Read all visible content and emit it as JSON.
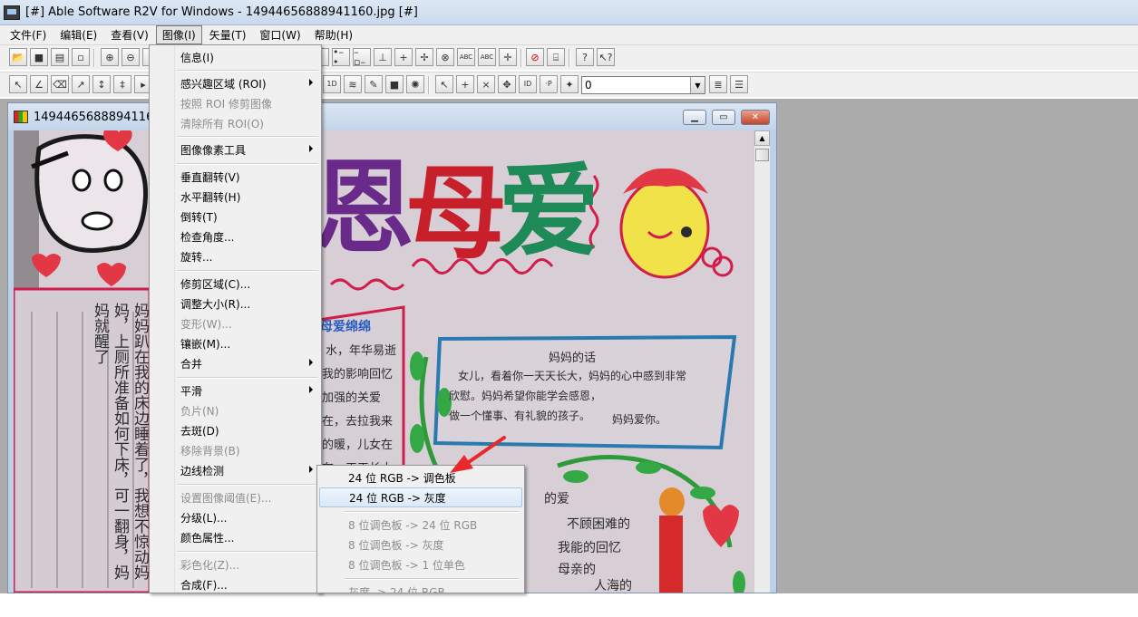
{
  "window": {
    "title": "[#] Able Software R2V for Windows - 14944656888941160.jpg [#]"
  },
  "menubar": {
    "items": [
      {
        "label": "文件(F)"
      },
      {
        "label": "编辑(E)"
      },
      {
        "label": "查看(V)"
      },
      {
        "label": "图像(I)"
      },
      {
        "label": "矢量(T)"
      },
      {
        "label": "窗口(W)"
      },
      {
        "label": "帮助(H)"
      }
    ]
  },
  "toolbar": {
    "zoom_value": "0"
  },
  "document": {
    "title": "14944656888941160.jpg"
  },
  "poster": {
    "title_chars": [
      "恩",
      "母",
      "爱"
    ],
    "box_heading": "妈妈的话",
    "box_text": [
      "女儿，看着你一天天长大，妈妈的心中感到非常",
      "欣慰。妈妈希望你能学会感恩，",
      "做一个懂事、有礼貌的孩子。",
      "妈妈爱你。"
    ],
    "section_label": "母爱绵绵",
    "left_column_text": "妈妈趴在我的床边睡着了，我想不惊动妈妈，上厕所准备如何下床，可一翻身，妈妈就醒了",
    "mid_text": [
      "水，年华易逝",
      "我的影响回忆",
      "加强的关爱",
      "在，去拉我来",
      "的暖，儿女在",
      "在一天天长大"
    ],
    "lower_text": [
      "的爱",
      "不顾困难的",
      "我能的回忆",
      "母亲的",
      "人海的"
    ]
  },
  "image_menu": {
    "items": [
      {
        "label": "信息(I)"
      },
      {
        "label": "感兴趣区域 (ROI)"
      },
      {
        "label": "按照 ROI 修剪图像"
      },
      {
        "label": "清除所有 ROI(O)"
      },
      {
        "label": "图像像素工具"
      },
      {
        "label": "垂直翻转(V)"
      },
      {
        "label": "水平翻转(H)"
      },
      {
        "label": "倒转(T)"
      },
      {
        "label": "检查角度..."
      },
      {
        "label": "旋转..."
      },
      {
        "label": "修剪区域(C)..."
      },
      {
        "label": "调整大小(R)..."
      },
      {
        "label": "变形(W)..."
      },
      {
        "label": "镶嵌(M)..."
      },
      {
        "label": "合并"
      },
      {
        "label": "平滑"
      },
      {
        "label": "负片(N)"
      },
      {
        "label": "去斑(D)"
      },
      {
        "label": "移除背景(B)"
      },
      {
        "label": "边线检测"
      },
      {
        "label": "设置图像阈值(E)..."
      },
      {
        "label": "分级(L)..."
      },
      {
        "label": "颜色属性..."
      },
      {
        "label": "彩色化(Z)..."
      },
      {
        "label": "合成(F)..."
      }
    ]
  },
  "edge_submenu": {
    "items": [
      {
        "label": "24 位 RGB -> 调色板"
      },
      {
        "label": "24 位 RGB -> 灰度"
      },
      {
        "label": "8 位调色板 -> 24 位 RGB"
      },
      {
        "label": "8 位调色板 -> 灰度"
      },
      {
        "label": "8 位调色板 -> 1 位单色"
      },
      {
        "label": "灰度 -> 24 位 RGB"
      }
    ]
  },
  "colors": {
    "menu_bg": "#f0f0f0",
    "workspace": "#ababab",
    "annotation_arrow": "#e8282a",
    "title_purple": "#6a2a8a",
    "title_red": "#c8202a",
    "title_green": "#1e8a58"
  }
}
